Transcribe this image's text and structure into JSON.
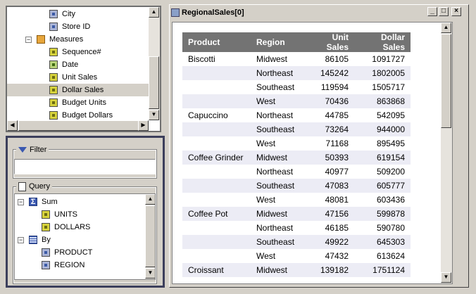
{
  "tree": {
    "items": [
      {
        "label": "City",
        "icon": "dimension-icon",
        "indent": 2
      },
      {
        "label": "Store ID",
        "icon": "dimension-icon",
        "indent": 2
      },
      {
        "label": "Measures",
        "icon": "cube-icon",
        "indent": 1,
        "expander": "−"
      },
      {
        "label": "Sequence#",
        "icon": "measure-icon",
        "indent": 2
      },
      {
        "label": "Date",
        "icon": "measure-green-icon",
        "indent": 2
      },
      {
        "label": "Unit Sales",
        "icon": "measure-icon",
        "indent": 2
      },
      {
        "label": "Dollar Sales",
        "icon": "measure-icon",
        "indent": 2,
        "selected": true
      },
      {
        "label": "Budget Units",
        "icon": "measure-icon",
        "indent": 2
      },
      {
        "label": "Budget Dollars",
        "icon": "measure-icon",
        "indent": 2
      }
    ]
  },
  "filter": {
    "label": "Filter",
    "value": ""
  },
  "query": {
    "label": "Query",
    "items": [
      {
        "label": "Sum",
        "icon": "sigma-icon",
        "expander": "−"
      },
      {
        "label": "UNITS",
        "icon": "measure-icon"
      },
      {
        "label": "DOLLARS",
        "icon": "measure-icon"
      },
      {
        "label": "By",
        "icon": "grid-icon",
        "expander": "−"
      },
      {
        "label": "PRODUCT",
        "icon": "dimension-icon"
      },
      {
        "label": "REGION",
        "icon": "dimension-icon"
      }
    ]
  },
  "window": {
    "title": "RegionalSales[0]",
    "minimize": "_",
    "maximize": "□",
    "close": "×"
  },
  "report": {
    "headers": [
      "Product",
      "Region",
      "Unit Sales",
      "Dollar Sales"
    ],
    "rows": [
      [
        "Biscotti",
        "Midwest",
        "86105",
        "1091727"
      ],
      [
        "",
        "Northeast",
        "145242",
        "1802005"
      ],
      [
        "",
        "Southeast",
        "119594",
        "1505717"
      ],
      [
        "",
        "West",
        "70436",
        "863868"
      ],
      [
        "Capuccino",
        "Northeast",
        "44785",
        "542095"
      ],
      [
        "",
        "Southeast",
        "73264",
        "944000"
      ],
      [
        "",
        "West",
        "71168",
        "895495"
      ],
      [
        "Coffee Grinder",
        "Midwest",
        "50393",
        "619154"
      ],
      [
        "",
        "Northeast",
        "40977",
        "509200"
      ],
      [
        "",
        "Southeast",
        "47083",
        "605777"
      ],
      [
        "",
        "West",
        "48081",
        "603436"
      ],
      [
        "Coffee Pot",
        "Midwest",
        "47156",
        "599878"
      ],
      [
        "",
        "Northeast",
        "46185",
        "590780"
      ],
      [
        "",
        "Southeast",
        "49922",
        "645303"
      ],
      [
        "",
        "West",
        "47432",
        "613624"
      ],
      [
        "Croissant",
        "Midwest",
        "139182",
        "1751124"
      ]
    ]
  },
  "colors": {
    "header_bg": "#737373",
    "alt_row": "#ececf5",
    "frame_dark": "#3c3f5c"
  }
}
